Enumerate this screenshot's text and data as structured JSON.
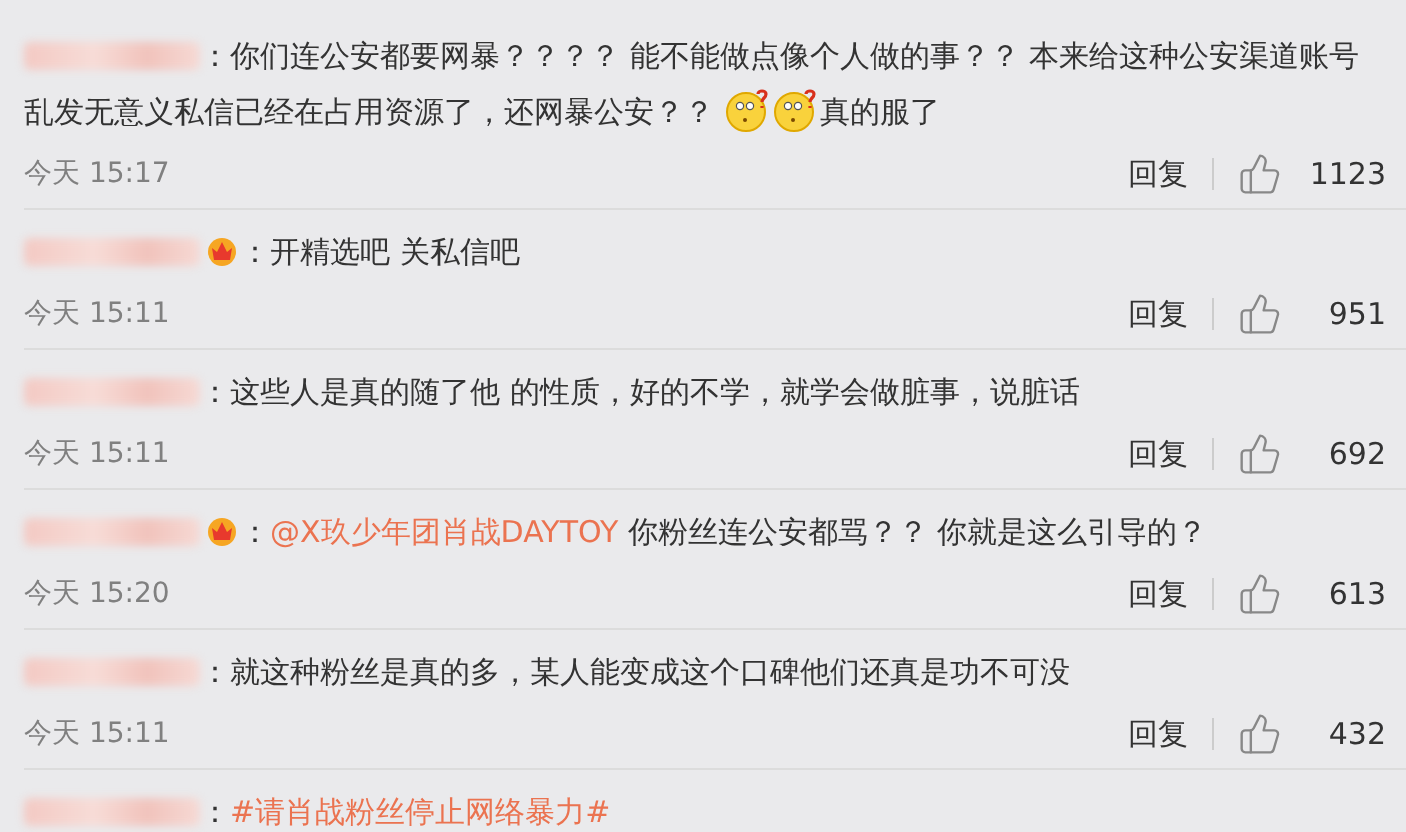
{
  "comments": [
    {
      "badge": false,
      "content": [
        {
          "kind": "text",
          "text": "：你们连公安都要网暴？？？？ 能不能做点像个人做的事？？ 本来给这种公安渠道账号乱发无意义私信已经在占用资源了，还网暴公安？？ "
        },
        {
          "kind": "emoji"
        },
        {
          "kind": "emoji"
        },
        {
          "kind": "text",
          "text": "真的服了"
        }
      ],
      "time": "今天 15:17",
      "reply": "回复",
      "likes": "1123"
    },
    {
      "badge": true,
      "content": [
        {
          "kind": "text",
          "text": "：开精选吧  关私信吧"
        }
      ],
      "time": "今天 15:11",
      "reply": "回复",
      "likes": "951"
    },
    {
      "badge": false,
      "content": [
        {
          "kind": "text",
          "text": "：这些人是真的随了他  的性质，好的不学，就学会做脏事，说脏话"
        }
      ],
      "time": "今天 15:11",
      "reply": "回复",
      "likes": "692"
    },
    {
      "badge": true,
      "content": [
        {
          "kind": "text",
          "text": "："
        },
        {
          "kind": "link",
          "text": "@X玖少年团肖战DAYTOY"
        },
        {
          "kind": "text",
          "text": " 你粉丝连公安都骂？？ 你就是这么引导的？"
        }
      ],
      "time": "今天 15:20",
      "reply": "回复",
      "likes": "613"
    },
    {
      "badge": false,
      "content": [
        {
          "kind": "text",
          "text": "：就这种粉丝是真的多，某人能变成这个口碑他们还真是功不可没"
        }
      ],
      "time": "今天 15:11",
      "reply": "回复",
      "likes": "432"
    },
    {
      "badge": false,
      "content": [
        {
          "kind": "text",
          "text": "："
        },
        {
          "kind": "link",
          "text": "#请肖战粉丝停止网络暴力#"
        }
      ]
    }
  ]
}
